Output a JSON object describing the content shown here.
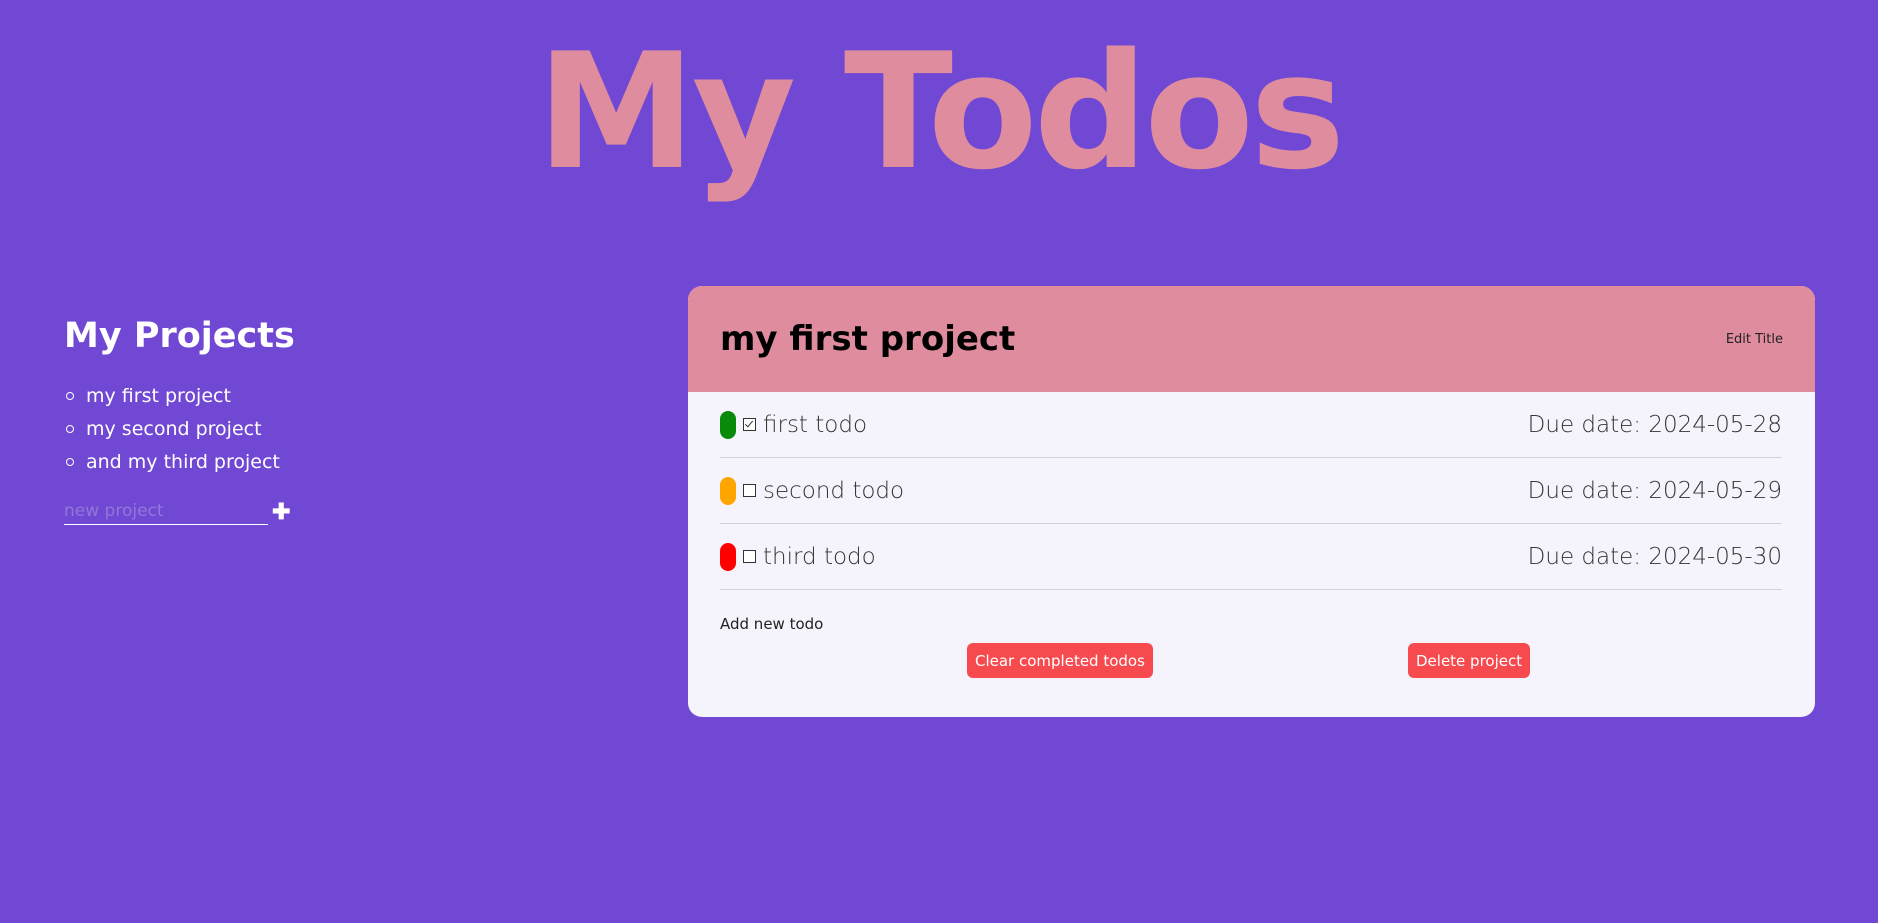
{
  "app": {
    "title": "My Todos"
  },
  "sidebar": {
    "heading": "My Projects",
    "projects": [
      {
        "label": "my first project"
      },
      {
        "label": "my second project"
      },
      {
        "label": "and my third project"
      }
    ],
    "new_project": {
      "placeholder": "new project",
      "value": "",
      "add_icon": "plus-icon",
      "add_label": "✚"
    }
  },
  "project": {
    "title": "my first project",
    "edit_title_label": "Edit Title",
    "todos": [
      {
        "title": "first todo",
        "due": "Due date: 2024-05-28",
        "done": true,
        "priority_color": "#0a8a0a"
      },
      {
        "title": "second todo",
        "due": "Due date: 2024-05-29",
        "done": false,
        "priority_color": "#ffa500"
      },
      {
        "title": "third todo",
        "due": "Due date: 2024-05-30",
        "done": false,
        "priority_color": "#ff0000"
      }
    ],
    "add_todo_label": "Add new todo",
    "clear_label": "Clear completed todos",
    "delete_label": "Delete project"
  },
  "colors": {
    "background": "#7048d3",
    "accent_pink": "#e08c9f",
    "card_background": "#f5f4fc",
    "button_red": "#f74a4f"
  }
}
